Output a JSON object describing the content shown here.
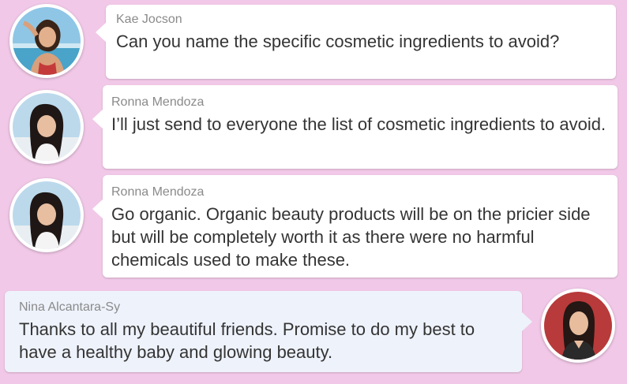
{
  "messages": [
    {
      "sender": "Kae Jocson",
      "text": "Can you name the specific cosmetic ingredients to avoid?",
      "avatar": "kae-jocson-avatar",
      "side": "left"
    },
    {
      "sender": "Ronna Mendoza",
      "text": "I’ll just send to everyone the list of cosmetic ingredients to avoid.",
      "avatar": "ronna-mendoza-avatar",
      "side": "left"
    },
    {
      "sender": "Ronna Mendoza",
      "text": "Go organic. Organic beauty products will be on the pricier side but will be completely worth it as there were no harmful chemicals used to make these.",
      "avatar": "ronna-mendoza-avatar",
      "side": "left"
    },
    {
      "sender": "Nina Alcantara-Sy",
      "text": "Thanks to all my beautiful friends. Promise to do my best to have a healthy baby and glowing beauty.",
      "avatar": "nina-alcantara-sy-avatar",
      "side": "right"
    }
  ],
  "colors": {
    "background": "#f1c8e7",
    "bubble_left": "#ffffff",
    "bubble_right": "#eef2fb",
    "sender_text": "#8a8a8a",
    "message_text": "#343434"
  }
}
